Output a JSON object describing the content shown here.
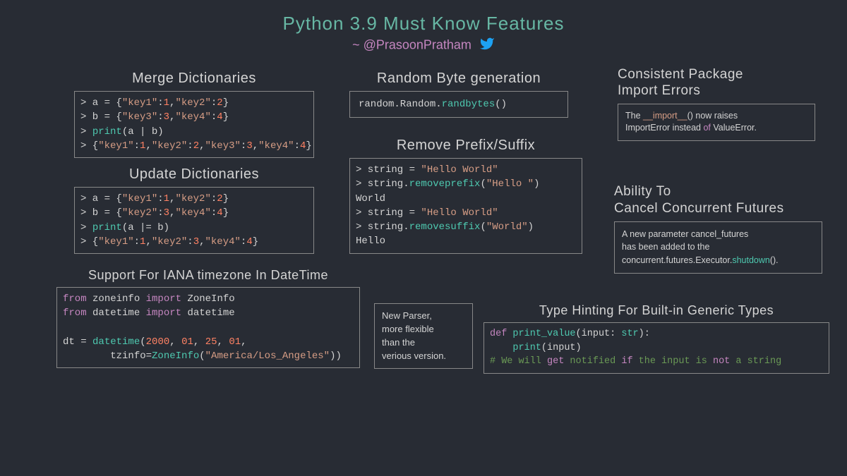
{
  "title": "Python 3.9 Must Know Features",
  "subtitle": "~ @PrasoonPratham",
  "sections": {
    "merge": {
      "title": "Merge Dictionaries",
      "code": "> a = {\"key1\":1,\"key2\":2}\n> b = {\"key3\":3,\"key4\":4}\n> print(a | b)\n> {\"key1\":1,\"key2\":2,\"key3\":3,\"key4\":4}"
    },
    "update": {
      "title": "Update Dictionaries",
      "code": "> a = {\"key1\":1,\"key2\":2}\n> b = {\"key2\":3,\"key4\":4}\n> print(a |= b)\n> {\"key1\":1,\"key2\":3,\"key4\":4}"
    },
    "iana": {
      "title": "Support For IANA timezone In DateTime",
      "code": "from zoneinfo import ZoneInfo\nfrom datetime import datetime\n\ndt = datetime(2000, 01, 25, 01,\n        tzinfo=ZoneInfo(\"America/Los_Angeles\"))"
    },
    "random": {
      "title": "Random Byte generation",
      "code": "random.Random.randbytes()"
    },
    "prefix": {
      "title": "Remove Prefix/Suffix",
      "code": "> string = \"Hello World\"\n> string.removeprefix(\"Hello \")\nWorld\n> string = \"Hello World\"\n> string.removesuffix(\"World\")\nHello"
    },
    "import_errors": {
      "title": "Consistent Package\nImport Errors",
      "text": "The __import__() now raises\nImportError instead of ValueError."
    },
    "cancel": {
      "title": "Ability To\nCancel Concurrent Futures",
      "text": "A new parameter cancel_futures\nhas been added to the\nconcurrent.futures.Executor.shutdown()."
    },
    "parser": {
      "text": "New Parser,\nmore flexible\nthan the\nverious version."
    },
    "typehint": {
      "title": "Type Hinting For Built-in Generic Types",
      "code": "def print_value(input: str):\n    print(input)\n# We will get notified if the input is not a string"
    }
  }
}
